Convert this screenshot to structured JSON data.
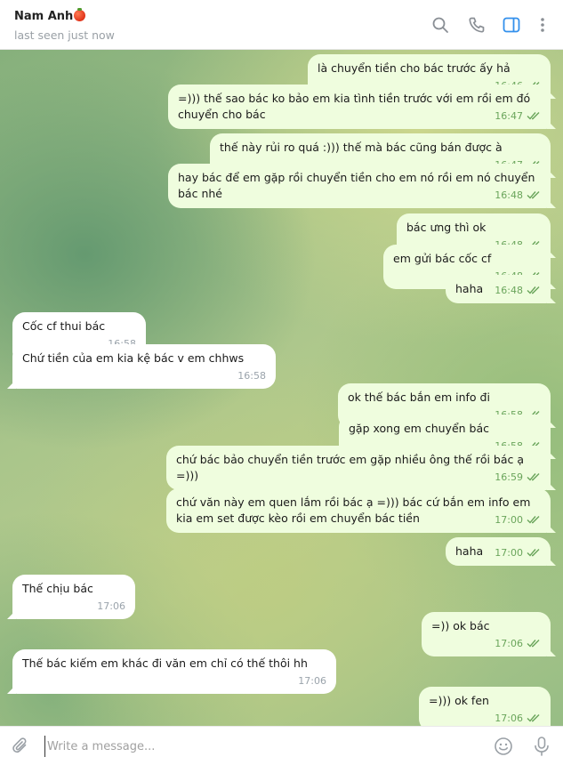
{
  "header": {
    "contact_name": "Nam Anh",
    "status": "last seen just now"
  },
  "icons": {
    "search": "search-icon",
    "call": "phone-icon",
    "sidebar": "sidebar-toggle-icon",
    "more": "more-vertical-icon",
    "attach": "paperclip-icon",
    "emoji": "emoji-icon",
    "voice": "microphone-icon"
  },
  "colors": {
    "outgoing_bubble": "#effdde",
    "incoming_bubble": "#ffffff",
    "accent": "#3390ec",
    "read_check": "#6aa55b"
  },
  "messages": [
    {
      "dir": "out",
      "text": "là chuyển tiền cho bác trước ấy hả",
      "time": "16:46"
    },
    {
      "dir": "out",
      "text": "=))) thế sao bác ko bảo em kia tình tiền trước với em rồi em đó chuyển cho bác",
      "time": "16:47"
    },
    {
      "dir": "out",
      "text": "thế này rủi ro quá :))) thế mà bác cũng bán được à",
      "time": "16:47"
    },
    {
      "dir": "out",
      "text": "hay bác để em gặp rồi chuyển tiền cho em nó rồi em nó chuyển bác nhé",
      "time": "16:48"
    },
    {
      "dir": "out",
      "text": "bác ưng thì ok",
      "time": "16:48"
    },
    {
      "dir": "out",
      "text": "em gửi bác cốc cf",
      "time": "16:48"
    },
    {
      "dir": "out",
      "text": "haha",
      "time": "16:48"
    },
    {
      "dir": "in",
      "text": "Cốc cf thui bác",
      "time": "16:58"
    },
    {
      "dir": "in",
      "text": "Chứ tiền của em kia kệ bác v em chhws",
      "time": "16:58"
    },
    {
      "dir": "out",
      "text": "ok thế bác bắn em info đi",
      "time": "16:58"
    },
    {
      "dir": "out",
      "text": "gặp xong em chuyển bác",
      "time": "16:58"
    },
    {
      "dir": "out",
      "text": "chứ bác bảo chuyển tiền trước em gặp nhiều ông thế rồi bác ạ =)))",
      "time": "16:59"
    },
    {
      "dir": "out",
      "text": "chứ văn này em quen lắm rồi bác ạ =))) bác cứ bắn em info em kia em set được kèo rồi em chuyển bác tiền",
      "time": "17:00"
    },
    {
      "dir": "out",
      "text": "haha",
      "time": "17:00"
    },
    {
      "dir": "in",
      "text": "Thế chịu bác",
      "time": "17:06"
    },
    {
      "dir": "out",
      "text": "=)) ok bác",
      "time": "17:06"
    },
    {
      "dir": "in",
      "text": "Thế bác kiếm em khác đi văn em chỉ có thế thôi hh",
      "time": "17:06"
    },
    {
      "dir": "out",
      "text": "=))) ok fen",
      "time": "17:06"
    }
  ],
  "composer": {
    "placeholder": "Write a message..."
  }
}
